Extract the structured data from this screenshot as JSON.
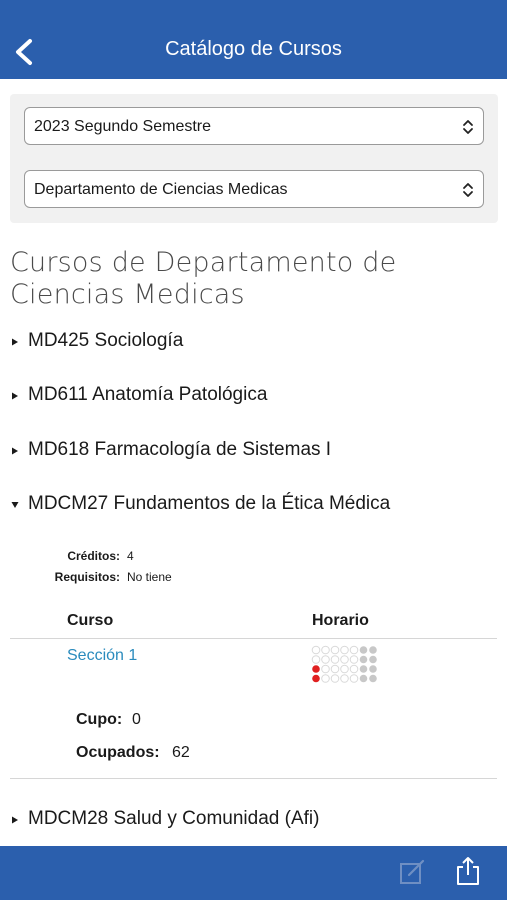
{
  "header": {
    "title": "Catálogo de Cursos",
    "back_icon": "chevron-left-icon"
  },
  "filters": {
    "semester": "2023 Segundo Semestre",
    "department": "Departamento de Ciencias Medicas"
  },
  "page_heading": "Cursos de Departamento de Ciencias Medicas",
  "courses": [
    {
      "label": "MD425 Sociología",
      "expanded": false
    },
    {
      "label": "MD611 Anatomía Patológica",
      "expanded": false
    },
    {
      "label": "MD618 Farmacología de Sistemas I",
      "expanded": false
    },
    {
      "label": "MDCM27 Fundamentos de la Ética Médica",
      "expanded": true
    },
    {
      "label": "MDCM28 Salud y Comunidad (Afi)",
      "expanded": false
    }
  ],
  "course_detail": {
    "credits_label": "Créditos:",
    "credits_value": "4",
    "requirements_label": "Requisitos:",
    "requirements_value": "No tiene",
    "table_headers": {
      "course": "Curso",
      "schedule": "Horario"
    },
    "section": {
      "name": "Sección 1",
      "quota_label": "Cupo:",
      "quota_value": "0",
      "occupied_label": "Ocupados:",
      "occupied_value": "62"
    }
  },
  "colors": {
    "bar": "#2b5fad",
    "link": "#2a8bbd",
    "slot_empty": "#d9d9d9",
    "slot_weekend": "#c8c8c8",
    "slot_active": "#e02020"
  },
  "bottom_bar": {
    "icons": [
      "edit-icon",
      "share-icon"
    ]
  }
}
